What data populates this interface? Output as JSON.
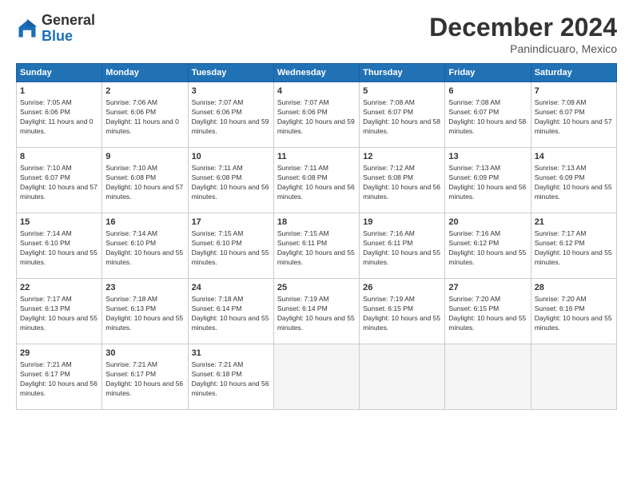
{
  "logo": {
    "general": "General",
    "blue": "Blue"
  },
  "title": "December 2024",
  "subtitle": "Panindicuaro, Mexico",
  "days_header": [
    "Sunday",
    "Monday",
    "Tuesday",
    "Wednesday",
    "Thursday",
    "Friday",
    "Saturday"
  ],
  "weeks": [
    [
      {
        "num": "1",
        "sunrise": "7:05 AM",
        "sunset": "6:06 PM",
        "daylight": "11 hours and 0 minutes."
      },
      {
        "num": "2",
        "sunrise": "7:06 AM",
        "sunset": "6:06 PM",
        "daylight": "11 hours and 0 minutes."
      },
      {
        "num": "3",
        "sunrise": "7:07 AM",
        "sunset": "6:06 PM",
        "daylight": "10 hours and 59 minutes."
      },
      {
        "num": "4",
        "sunrise": "7:07 AM",
        "sunset": "6:06 PM",
        "daylight": "10 hours and 59 minutes."
      },
      {
        "num": "5",
        "sunrise": "7:08 AM",
        "sunset": "6:07 PM",
        "daylight": "10 hours and 58 minutes."
      },
      {
        "num": "6",
        "sunrise": "7:08 AM",
        "sunset": "6:07 PM",
        "daylight": "10 hours and 58 minutes."
      },
      {
        "num": "7",
        "sunrise": "7:09 AM",
        "sunset": "6:07 PM",
        "daylight": "10 hours and 57 minutes."
      }
    ],
    [
      {
        "num": "8",
        "sunrise": "7:10 AM",
        "sunset": "6:07 PM",
        "daylight": "10 hours and 57 minutes."
      },
      {
        "num": "9",
        "sunrise": "7:10 AM",
        "sunset": "6:08 PM",
        "daylight": "10 hours and 57 minutes."
      },
      {
        "num": "10",
        "sunrise": "7:11 AM",
        "sunset": "6:08 PM",
        "daylight": "10 hours and 56 minutes."
      },
      {
        "num": "11",
        "sunrise": "7:11 AM",
        "sunset": "6:08 PM",
        "daylight": "10 hours and 56 minutes."
      },
      {
        "num": "12",
        "sunrise": "7:12 AM",
        "sunset": "6:08 PM",
        "daylight": "10 hours and 56 minutes."
      },
      {
        "num": "13",
        "sunrise": "7:13 AM",
        "sunset": "6:09 PM",
        "daylight": "10 hours and 56 minutes."
      },
      {
        "num": "14",
        "sunrise": "7:13 AM",
        "sunset": "6:09 PM",
        "daylight": "10 hours and 55 minutes."
      }
    ],
    [
      {
        "num": "15",
        "sunrise": "7:14 AM",
        "sunset": "6:10 PM",
        "daylight": "10 hours and 55 minutes."
      },
      {
        "num": "16",
        "sunrise": "7:14 AM",
        "sunset": "6:10 PM",
        "daylight": "10 hours and 55 minutes."
      },
      {
        "num": "17",
        "sunrise": "7:15 AM",
        "sunset": "6:10 PM",
        "daylight": "10 hours and 55 minutes."
      },
      {
        "num": "18",
        "sunrise": "7:15 AM",
        "sunset": "6:11 PM",
        "daylight": "10 hours and 55 minutes."
      },
      {
        "num": "19",
        "sunrise": "7:16 AM",
        "sunset": "6:11 PM",
        "daylight": "10 hours and 55 minutes."
      },
      {
        "num": "20",
        "sunrise": "7:16 AM",
        "sunset": "6:12 PM",
        "daylight": "10 hours and 55 minutes."
      },
      {
        "num": "21",
        "sunrise": "7:17 AM",
        "sunset": "6:12 PM",
        "daylight": "10 hours and 55 minutes."
      }
    ],
    [
      {
        "num": "22",
        "sunrise": "7:17 AM",
        "sunset": "6:13 PM",
        "daylight": "10 hours and 55 minutes."
      },
      {
        "num": "23",
        "sunrise": "7:18 AM",
        "sunset": "6:13 PM",
        "daylight": "10 hours and 55 minutes."
      },
      {
        "num": "24",
        "sunrise": "7:18 AM",
        "sunset": "6:14 PM",
        "daylight": "10 hours and 55 minutes."
      },
      {
        "num": "25",
        "sunrise": "7:19 AM",
        "sunset": "6:14 PM",
        "daylight": "10 hours and 55 minutes."
      },
      {
        "num": "26",
        "sunrise": "7:19 AM",
        "sunset": "6:15 PM",
        "daylight": "10 hours and 55 minutes."
      },
      {
        "num": "27",
        "sunrise": "7:20 AM",
        "sunset": "6:15 PM",
        "daylight": "10 hours and 55 minutes."
      },
      {
        "num": "28",
        "sunrise": "7:20 AM",
        "sunset": "6:16 PM",
        "daylight": "10 hours and 55 minutes."
      }
    ],
    [
      {
        "num": "29",
        "sunrise": "7:21 AM",
        "sunset": "6:17 PM",
        "daylight": "10 hours and 56 minutes."
      },
      {
        "num": "30",
        "sunrise": "7:21 AM",
        "sunset": "6:17 PM",
        "daylight": "10 hours and 56 minutes."
      },
      {
        "num": "31",
        "sunrise": "7:21 AM",
        "sunset": "6:18 PM",
        "daylight": "10 hours and 56 minutes."
      },
      null,
      null,
      null,
      null
    ]
  ],
  "labels": {
    "sunrise": "Sunrise:",
    "sunset": "Sunset:",
    "daylight": "Daylight:"
  }
}
